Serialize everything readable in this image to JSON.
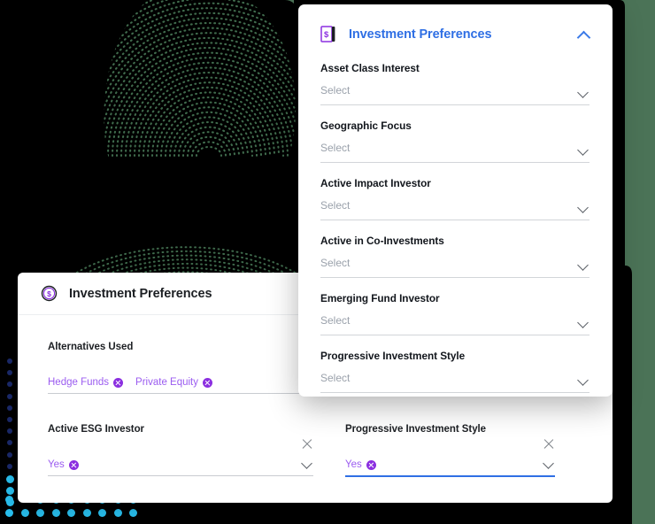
{
  "theme": {
    "background_green": "#4b7357",
    "art_black": "#000000",
    "card_white": "#ffffff",
    "accent_blue": "#2f6fe4",
    "chip_purple": "#9b5cf0",
    "chip_badge_purple": "#8b2fe0",
    "placeholder_grey": "#9aa1ab",
    "dot_navy": "#1b2a6b",
    "dot_cyan": "#29c0ef"
  },
  "float_panel": {
    "icon": "document-dollar-icon",
    "title": "Investment Preferences",
    "collapse_icon": "chevron-up-icon",
    "fields": [
      {
        "label": "Asset Class Interest",
        "value": "Select",
        "caret": "chevron-down-icon"
      },
      {
        "label": "Geographic Focus",
        "value": "Select",
        "caret": "chevron-down-icon"
      },
      {
        "label": "Active Impact Investor",
        "value": "Select",
        "caret": "chevron-down-icon"
      },
      {
        "label": "Active in Co-Investments",
        "value": "Select",
        "caret": "chevron-down-icon"
      },
      {
        "label": "Emerging Fund Investor",
        "value": "Select",
        "caret": "chevron-down-icon"
      },
      {
        "label": "Progressive Investment Style",
        "value": "Select",
        "caret": "chevron-down-icon"
      }
    ]
  },
  "bottom_card": {
    "icon": "circled-dollar-icon",
    "title": "Investment Preferences",
    "fields": {
      "alternatives_used": {
        "label": "Alternatives Used",
        "chips": [
          {
            "text": "Hedge Funds",
            "remove_icon": "chip-remove-icon"
          },
          {
            "text": "Private Equity",
            "remove_icon": "chip-remove-icon"
          }
        ],
        "clear_icon": "clear-icon",
        "caret": "chevron-down-icon"
      },
      "active_esg_investor": {
        "label": "Active ESG Investor",
        "chips": [
          {
            "text": "Yes",
            "remove_icon": "chip-remove-icon"
          }
        ],
        "clear_icon": "clear-icon",
        "caret": "chevron-down-icon",
        "focused": false
      },
      "progressive_investment_style": {
        "label": "Progressive Investment Style",
        "chips": [
          {
            "text": "Yes",
            "remove_icon": "chip-remove-icon"
          }
        ],
        "clear_icon": "clear-icon",
        "caret": "chevron-down-icon",
        "focused": true
      }
    }
  },
  "decoration": {
    "fingerprint": "dotted-concentric-arcs-graphic",
    "dot_grid": "blue-dot-grid-graphic"
  }
}
